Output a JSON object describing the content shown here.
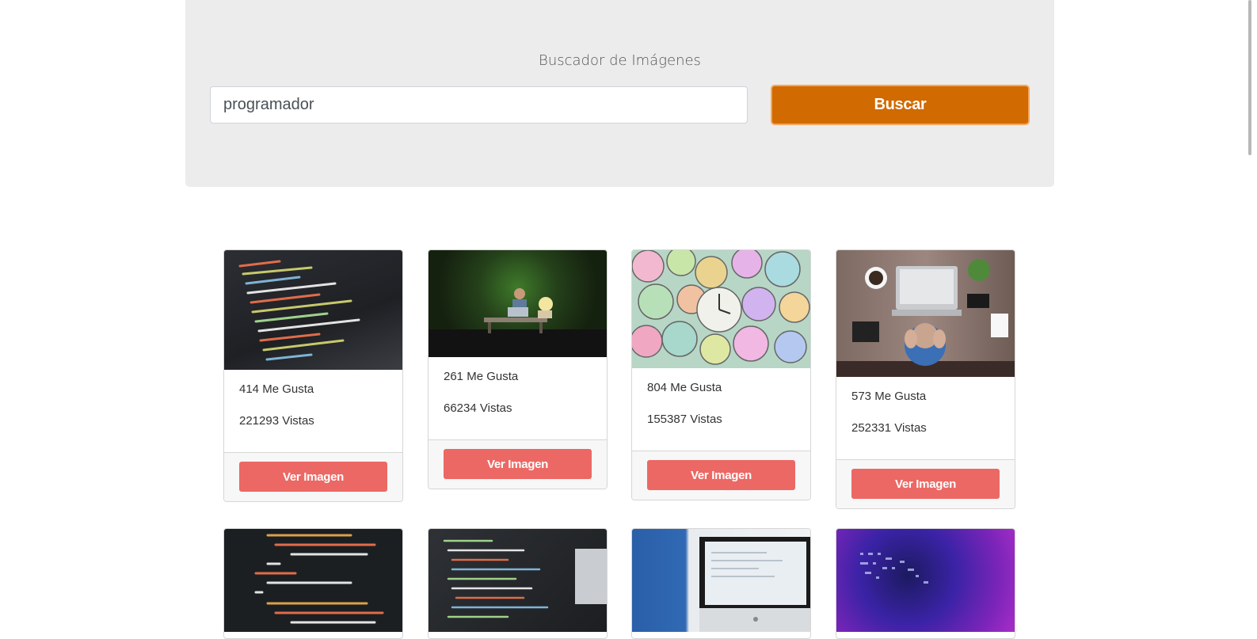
{
  "search": {
    "heading": "Buscador de Imágenes",
    "input_value": "programador",
    "button_label": "Buscar"
  },
  "cards": [
    {
      "likes": "414 Me Gusta",
      "views": "221293 Vistas",
      "button": "Ver Imagen",
      "image": "code-screen-image"
    },
    {
      "likes": "261 Me Gusta",
      "views": "66234 Vistas",
      "button": "Ver Imagen",
      "image": "person-laptop-bench-image"
    },
    {
      "likes": "804 Me Gusta",
      "views": "155387 Vistas",
      "button": "Ver Imagen",
      "image": "clocks-image"
    },
    {
      "likes": "573 Me Gusta",
      "views": "252331 Vistas",
      "button": "Ver Imagen",
      "image": "stressed-person-desk-image"
    }
  ],
  "partial_cards": [
    {
      "image": "code-editor-image"
    },
    {
      "image": "code-monitor-image"
    },
    {
      "image": "imac-user-image"
    },
    {
      "image": "matrix-code-image"
    }
  ],
  "colors": {
    "search_button": "#d16a00",
    "card_button": "#ec6864",
    "jumbotron": "#ececec"
  }
}
